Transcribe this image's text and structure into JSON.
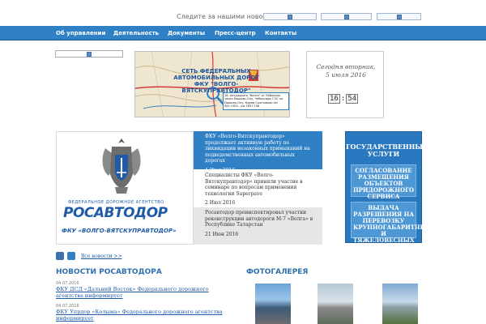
{
  "header": {
    "follow_text": "Следите за нашими новостями",
    "social_icons": [
      "social-icon-1",
      "social-icon-2",
      "social-icon-3"
    ]
  },
  "nav": {
    "items": [
      {
        "label": "Об управлении"
      },
      {
        "label": "Деятельность"
      },
      {
        "label": "Документы"
      },
      {
        "label": "Пресс-центр"
      },
      {
        "label": "Контакты"
      }
    ]
  },
  "banner": {
    "title": "СЕТЬ ФЕДЕРАЛЬНЫХ АВТОМОБИЛЬНЫХ ДОРОГ ФКУ \"ВОЛГО-ВЯТСКУПРАВТОДОР\"",
    "caption": "16. Автодорога \"Волга\" от Чебоксар через Йошкар-Олу, Чебоксары ГЭС на Йошкар-Олу, Киров Сыктывкар км 581+000 - км 785+136"
  },
  "datebox": {
    "line1": "Сегодня вторник,",
    "line2": "5 июля 2016",
    "hours": "16",
    "minutes": "54"
  },
  "logo": {
    "agency": "ФЕДЕРАЛЬНОЕ ДОРОЖНОЕ АГЕНТСТВО",
    "name": "РОСАВТОДОР",
    "fku": "ФКУ «ВОЛГО-ВЯТСКУПРАВТОДОР»"
  },
  "featured_news": [
    {
      "text": "ФКУ «Волго-Вятскуправтодор» продолжает активную работу по ликвидации незаконных примыканий на подведомственных автомобильных дорогах",
      "date": "4 Июл 2016"
    },
    {
      "text": "Специалисты ФКУ «Волго-Вятскуправтодор» приняли участие в семинаре по вопросам применения технологии Superpave",
      "date": "2 Июл 2016"
    },
    {
      "text": "Росавтодор проинспектировал участки реконструкции автодороги М-7 «Волга» в Республике Татарстан",
      "date": "21 Июн 2016"
    }
  ],
  "services": {
    "title": "ГОСУДАРСТВЕННЫЕ УСЛУГИ",
    "buttons": [
      {
        "label": "СОГЛАСОВАНИЕ РАЗМЕЩЕНИЯ ОБЪЕКТОВ ПРИДОРОЖНОГО СЕРВИСА"
      },
      {
        "label": "ВЫДАЧА РАЗРЕШЕНИЯ НА ПЕРЕВОЗКУ КРУПНОГАБАРИТНЫХ И ТЯЖЕЛОВЕСНЫХ ГРУЗОВ"
      }
    ]
  },
  "all_news_label": "Все новости >>",
  "news_section": {
    "title": "НОВОСТИ РОСАВТОДОРА",
    "items": [
      {
        "date": "04.07.2016",
        "text": "ФКУ ДСД «Дальний Восток» Федерального дорожного агентства информирует"
      },
      {
        "date": "04.07.2016",
        "text": "ФКУ Упрдор «Колыма» Федерального дорожного агентства информирует"
      }
    ]
  },
  "gallery": {
    "title": "ФОТОГАЛЕРЕЯ"
  },
  "colors": {
    "nav_blue": "#2f80c4",
    "brand_blue": "#1f5ba8",
    "services_blue": "#2a79c0"
  }
}
